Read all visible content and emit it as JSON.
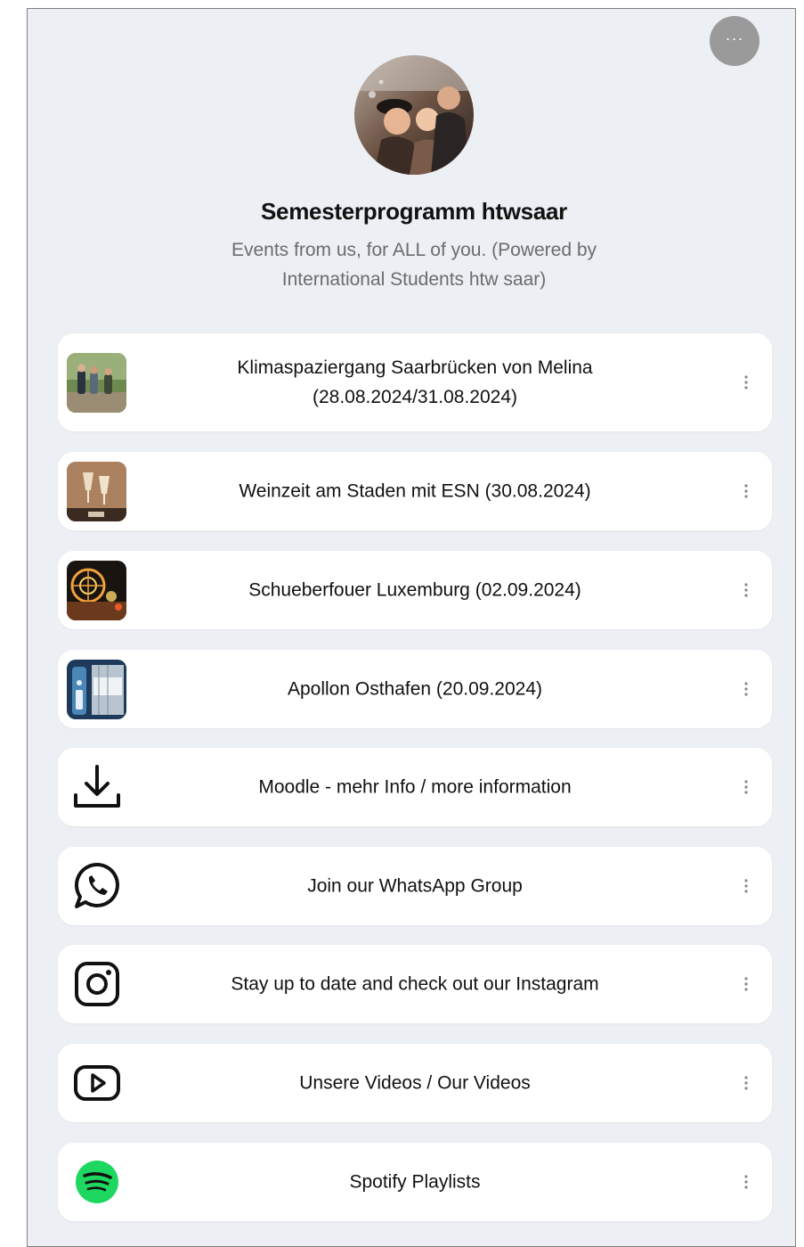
{
  "profile": {
    "title": "Semesterprogramm htwsaar",
    "subtitle": "Events from us, for ALL of you. (Powered by International Students htw saar)",
    "more_label": "···"
  },
  "links": [
    {
      "label": "Klimaspaziergang Saarbrücken von Melina (28.08.2024/31.08.2024)",
      "icon": "hiking-photo-thumbnail"
    },
    {
      "label": "Weinzeit am Staden mit ESN (30.08.2024)",
      "icon": "wine-glasses-photo-thumbnail"
    },
    {
      "label": "Schueberfouer Luxemburg (02.09.2024)",
      "icon": "fair-ferris-wheel-photo-thumbnail"
    },
    {
      "label": "Apollon Osthafen (20.09.2024)",
      "icon": "apollon-photo-thumbnail"
    },
    {
      "label": "Moodle - mehr Info / more information",
      "icon": "download-icon"
    },
    {
      "label": "Join our WhatsApp Group",
      "icon": "whatsapp-icon"
    },
    {
      "label": "Stay up to date and check out our Instagram",
      "icon": "instagram-icon"
    },
    {
      "label": "Unsere Videos / Our Videos",
      "icon": "youtube-icon"
    },
    {
      "label": "Spotify Playlists",
      "icon": "spotify-icon"
    }
  ],
  "colors": {
    "background": "#eceff3",
    "card": "#ffffff",
    "more_button": "#9a9a9a",
    "spotify": "#1ed760"
  }
}
